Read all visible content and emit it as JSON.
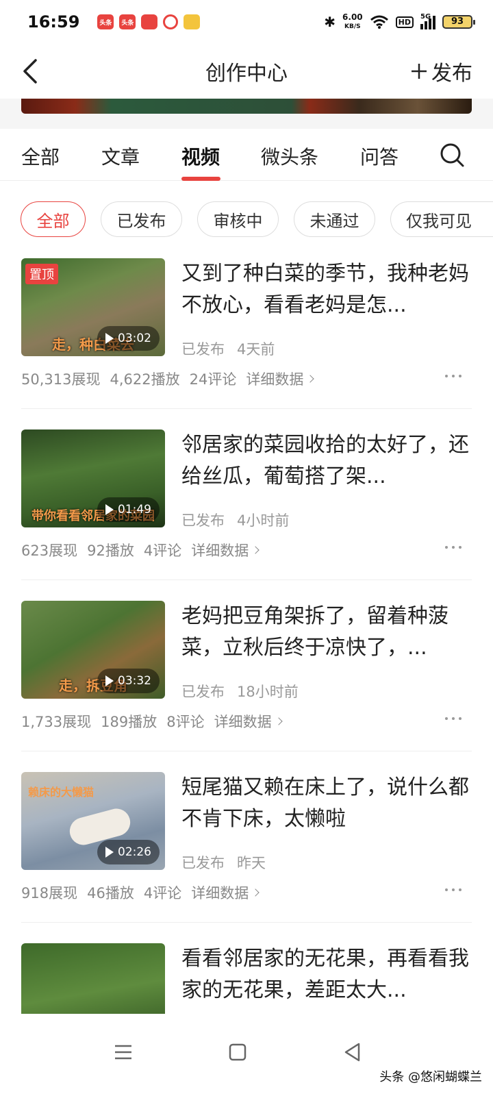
{
  "status_bar": {
    "time": "16:59",
    "net_speed_value": "6.00",
    "net_speed_unit": "KB/S",
    "hd": "HD",
    "signal": "5G",
    "battery": "93",
    "app_icons": [
      "头条",
      "头条",
      "app",
      "app",
      "app"
    ]
  },
  "header": {
    "title": "创作中心",
    "publish_label": "发布",
    "publish_icon": "plus-icon",
    "back_icon": "chevron-left-icon"
  },
  "tabs": [
    "全部",
    "文章",
    "视频",
    "微头条",
    "问答"
  ],
  "active_tab": "视频",
  "filters": [
    "全部",
    "已发布",
    "审核中",
    "未通过",
    "仅我可见"
  ],
  "active_filter": "全部",
  "items": [
    {
      "title": "又到了种白菜的季节，我种老妈不放心，看看老妈是怎...",
      "status": "已发布",
      "time": "4天前",
      "duration": "03:02",
      "pinned_label": "置顶",
      "caption": "走，种白菜去",
      "impressions": "50,313展现",
      "plays": "4,622播放",
      "comments": "24评论",
      "detail_label": "详细数据"
    },
    {
      "title": "邻居家的菜园收拾的太好了，还给丝瓜，葡萄搭了架...",
      "status": "已发布",
      "time": "4小时前",
      "duration": "01:49",
      "caption": "带你看看邻居家的菜园",
      "impressions": "623展现",
      "plays": "92播放",
      "comments": "4评论",
      "detail_label": "详细数据"
    },
    {
      "title": "老妈把豆角架拆了，留着种菠菜，立秋后终于凉快了，...",
      "status": "已发布",
      "time": "18小时前",
      "duration": "03:32",
      "caption": "走，拆豆角",
      "impressions": "1,733展现",
      "plays": "189播放",
      "comments": "8评论",
      "detail_label": "详细数据"
    },
    {
      "title": "短尾猫又赖在床上了，说什么都不肯下床，太懒啦",
      "status": "已发布",
      "time": "昨天",
      "duration": "02:26",
      "caption": "赖床的大懒猫",
      "impressions": "918展现",
      "plays": "46播放",
      "comments": "4评论",
      "detail_label": "详细数据"
    },
    {
      "title": "看看邻居家的无花果，再看看我家的无花果，差距太大..."
    }
  ],
  "watermark": "头条 @悠闲蝴蝶兰",
  "colors": {
    "accent": "#e8433f",
    "muted": "#999999"
  }
}
